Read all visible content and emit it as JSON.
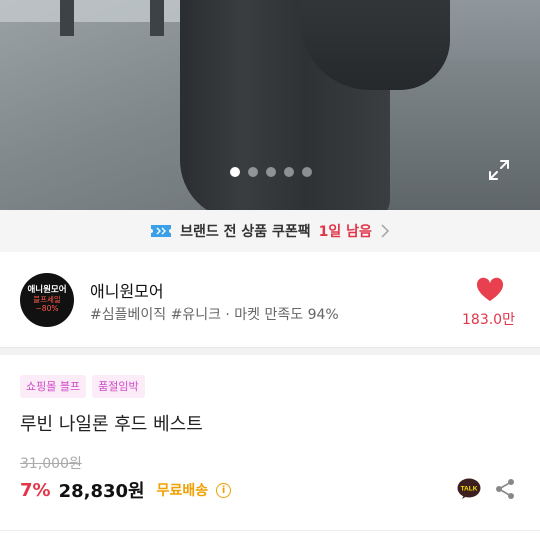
{
  "carousel": {
    "total_slides": 5,
    "active_index": 0
  },
  "coupon_bar": {
    "label": "브랜드 전 상품 쿠폰팩",
    "remaining": "1일 남음"
  },
  "shop": {
    "logo_line1": "애니원모어",
    "logo_line2": "블프세일",
    "logo_line3": "~80%",
    "name": "애니원모어",
    "tags": "#심플베이직 #유니크 · 마켓 만족도 94%",
    "likes": "183.0만"
  },
  "product": {
    "badges": [
      "쇼핑몰 블프",
      "품절임박"
    ],
    "name": "루빈 나일론 후드 베스트",
    "original_price": "31,000원",
    "discount": "7%",
    "price": "28,830원",
    "shipping": "무료배송",
    "info_icon": "i"
  },
  "colors": {
    "accent_red": "#e0364a",
    "badge_pink": "#d14ac7",
    "shipping_yellow": "#f0a000"
  },
  "icons": {
    "expand": "expand-icon",
    "ticket": "ticket-icon",
    "heart": "heart-icon",
    "talk": "kakaotalk-icon",
    "share": "share-icon"
  }
}
